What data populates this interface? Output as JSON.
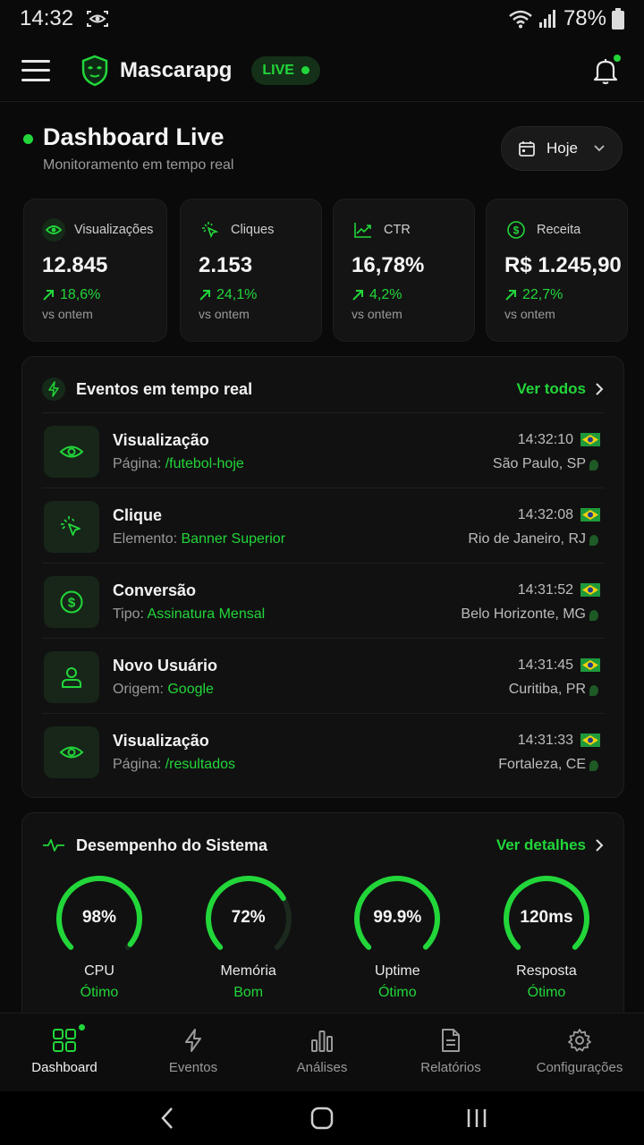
{
  "status_bar": {
    "time": "14:32",
    "battery": "78%"
  },
  "header": {
    "app_title": "Mascarapg",
    "live_label": "LIVE"
  },
  "dashboard": {
    "title": "Dashboard Live",
    "subtitle": "Monitoramento em tempo real",
    "date_filter": "Hoje"
  },
  "metrics": [
    {
      "label": "Visualizações",
      "value": "12.845",
      "change": "18,6%",
      "vs": "vs ontem",
      "icon": "eye-icon"
    },
    {
      "label": "Cliques",
      "value": "2.153",
      "change": "24,1%",
      "vs": "vs ontem",
      "icon": "cursor-click-icon"
    },
    {
      "label": "CTR",
      "value": "16,78%",
      "change": "4,2%",
      "vs": "vs ontem",
      "icon": "trend-line-icon"
    },
    {
      "label": "Receita",
      "value": "R$ 1.245,90",
      "change": "22,7%",
      "vs": "vs ontem",
      "icon": "dollar-icon"
    }
  ],
  "events_panel": {
    "title": "Eventos em tempo real",
    "link": "Ver todos",
    "items": [
      {
        "title": "Visualização",
        "sub_label": "Página:",
        "sub_value": "/futebol-hoje",
        "time": "14:32:10",
        "location": "São Paulo, SP",
        "icon": "eye-icon"
      },
      {
        "title": "Clique",
        "sub_label": "Elemento:",
        "sub_value": "Banner Superior",
        "time": "14:32:08",
        "location": "Rio de Janeiro, RJ",
        "icon": "cursor-click-icon"
      },
      {
        "title": "Conversão",
        "sub_label": "Tipo:",
        "sub_value": "Assinatura Mensal",
        "time": "14:31:52",
        "location": "Belo Horizonte, MG",
        "icon": "dollar-icon"
      },
      {
        "title": "Novo Usuário",
        "sub_label": "Origem:",
        "sub_value": "Google",
        "time": "14:31:45",
        "location": "Curitiba, PR",
        "icon": "user-icon"
      },
      {
        "title": "Visualização",
        "sub_label": "Página:",
        "sub_value": "/resultados",
        "time": "14:31:33",
        "location": "Fortaleza, CE",
        "icon": "eye-icon"
      }
    ]
  },
  "performance_panel": {
    "title": "Desempenho do Sistema",
    "link": "Ver detalhes",
    "gauges": [
      {
        "value": "98%",
        "label": "CPU",
        "status": "Ótimo",
        "fraction": 0.98
      },
      {
        "value": "72%",
        "label": "Memória",
        "status": "Bom",
        "fraction": 0.72
      },
      {
        "value": "99.9%",
        "label": "Uptime",
        "status": "Ótimo",
        "fraction": 0.999
      },
      {
        "value": "120ms",
        "label": "Resposta",
        "status": "Ótimo",
        "fraction": 1.0
      }
    ]
  },
  "bottom_nav": [
    {
      "label": "Dashboard",
      "active": true
    },
    {
      "label": "Eventos"
    },
    {
      "label": "Análises"
    },
    {
      "label": "Relatórios"
    },
    {
      "label": "Configurações"
    }
  ],
  "colors": {
    "accent": "#22d63a",
    "background": "#0a0a0a",
    "card": "#141414"
  }
}
